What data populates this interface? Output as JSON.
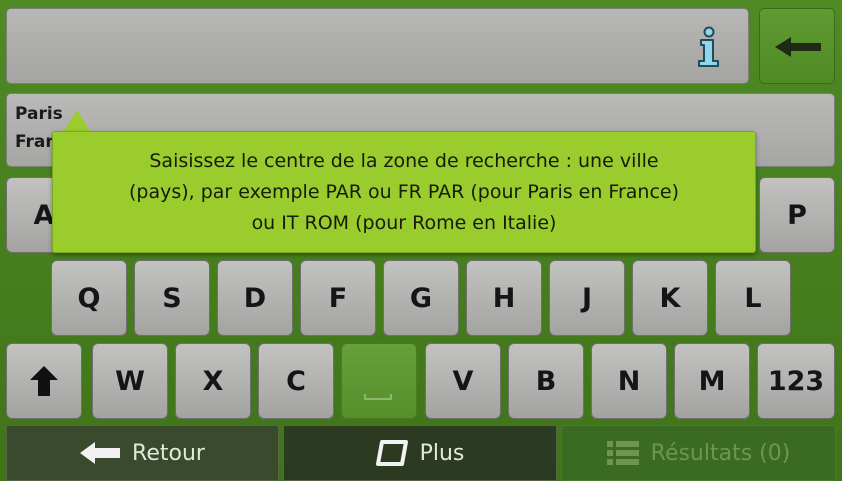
{
  "search": {
    "value": ""
  },
  "suggestion": {
    "city": "Paris",
    "country": "France"
  },
  "tooltip": {
    "lines": [
      "Saisissez le centre de la zone de recherche : une ville",
      "(pays), par exemple PAR ou FR PAR (pour Paris en France)",
      "ou IT ROM (pour Rome en Italie)"
    ]
  },
  "keyboard": {
    "row1": [
      "A",
      "P"
    ],
    "row2": [
      "Q",
      "S",
      "D",
      "F",
      "G",
      "H",
      "J",
      "K",
      "L"
    ],
    "row3": [
      "W",
      "X",
      "C",
      "V",
      "B",
      "N",
      "M"
    ],
    "numbers_label": "123"
  },
  "bottom_bar": {
    "back_label": "Retour",
    "more_label": "Plus",
    "results_label": "Résultats (0)"
  },
  "icons": {
    "info": "info-icon",
    "backspace": "backspace-arrow-icon",
    "shift": "shift-up-arrow-icon",
    "back": "back-arrow-icon",
    "more": "rounded-square-icon",
    "results": "list-icon"
  },
  "colors": {
    "background": "#4f8a24",
    "tooltip": "#99cc2c",
    "key": "#b3b3b1",
    "disabled_text": "#6e9552"
  }
}
